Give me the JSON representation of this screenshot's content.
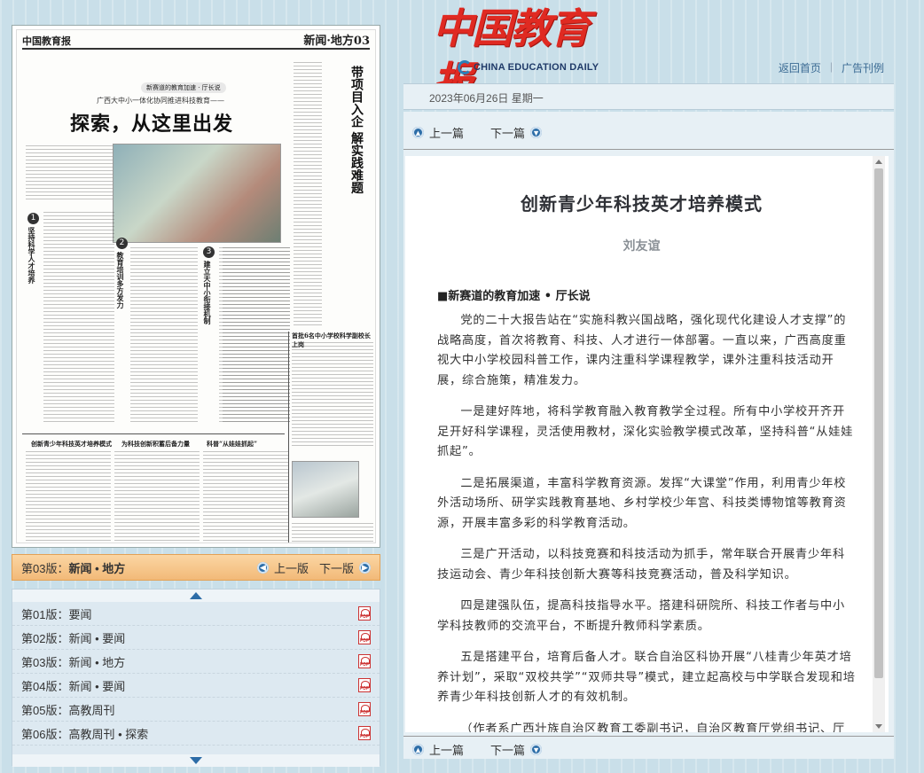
{
  "masthead": {
    "logo_cn": "中国教育报",
    "logo_en": "CHINA EDUCATION DAILY"
  },
  "top_links": {
    "home": "返回首页",
    "ads": "广告刊例"
  },
  "date_text": "2023年06月26日  星期一",
  "newspaper_page": {
    "header_logo": "中国教育报",
    "section": "新闻·地方",
    "page_no": "03",
    "tag": "新赛道的教育加速 · 厅长说",
    "kicker": "广西大中小一体化协同推进科技教育——",
    "headline": "探索，从这里出发",
    "vertical_title": "带项目入企 解实践难题",
    "bottom_title_1": "创新青少年科技英才培养模式",
    "bottom_title_2": "为科技创新积蓄后备力量",
    "bottom_title_3": "科普“从娃娃抓起”",
    "sidebar_title": "首批6名中小学校科学副校长上岗"
  },
  "page_nav": {
    "current_label": "第03版：",
    "current_name": "新闻 • 地方",
    "prev": "上一版",
    "next": "下一版"
  },
  "page_list": [
    {
      "label": "第01版：要闻"
    },
    {
      "label": "第02版：新闻 • 要闻"
    },
    {
      "label": "第03版：新闻 • 地方"
    },
    {
      "label": "第04版：新闻 • 要闻"
    },
    {
      "label": "第05版：高教周刊"
    },
    {
      "label": "第06版：高教周刊 • 探索"
    }
  ],
  "article_nav": {
    "prev": "上一篇",
    "next": "下一篇"
  },
  "article": {
    "title": "创新青少年科技英才培养模式",
    "author": "刘友谊",
    "section": "■新赛道的教育加速 • 厅长说",
    "paragraphs": [
      "党的二十大报告站在“实施科教兴国战略，强化现代化建设人才支撑”的战略高度，首次将教育、科技、人才进行一体部署。一直以来，广西高度重视大中小学校园科普工作，课内注重科学课程教学，课外注重科技活动开展，综合施策，精准发力。",
      "一是建好阵地，将科学教育融入教育教学全过程。所有中小学校开齐开足开好科学课程，灵活使用教材，深化实验教学模式改革，坚持科普“从娃娃抓起”。",
      "二是拓展渠道，丰富科学教育资源。发挥“大课堂”作用，利用青少年校外活动场所、研学实践教育基地、乡村学校少年宫、科技类博物馆等教育资源，开展丰富多彩的科学教育活动。",
      "三是广开活动，以科技竞赛和科技活动为抓手，常年联合开展青少年科技运动会、青少年科技创新大赛等科技竞赛活动，普及科学知识。",
      "四是建强队伍，提高科技指导水平。搭建科研院所、科技工作者与中小学科技教师的交流平台，不断提升教师科学素质。",
      "五是搭建平台，培育后备人才。联合自治区科协开展“八桂青少年英才培养计划”，采取“双校共学”“双师共导”模式，建立起高校与中学联合发现和培养青少年科技创新人才的有效机制。",
      "（作者系广西壮族自治区教育工委副书记，自治区教育厅党组书记、厅长）"
    ]
  }
}
